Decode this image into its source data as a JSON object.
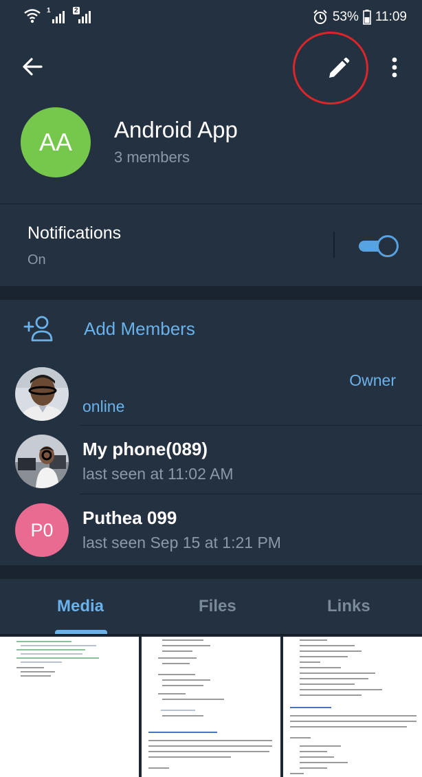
{
  "status_bar": {
    "sim1": "1",
    "sim2": "2",
    "battery_percent": "53%",
    "time": "11:09"
  },
  "header": {
    "group_name": "Android App",
    "member_count": "3 members",
    "avatar_initials": "AA",
    "avatar_color": "#76c84d"
  },
  "notifications": {
    "label": "Notifications",
    "value": "On",
    "enabled": true
  },
  "members_section": {
    "add_label": "Add Members",
    "members": [
      {
        "name": "",
        "status": "online",
        "role": "Owner"
      },
      {
        "name": "My phone(089)",
        "status": "last seen at 11:02 AM",
        "role": ""
      },
      {
        "name": "Puthea 099",
        "status": "last seen Sep 15 at 1:21 PM",
        "role": "",
        "initials": "P0",
        "avatar_color": "#ea6b91"
      }
    ]
  },
  "tabs": [
    {
      "label": "Media",
      "active": true
    },
    {
      "label": "Files",
      "active": false
    },
    {
      "label": "Links",
      "active": false
    }
  ],
  "icons": {
    "back": "arrow-left-icon",
    "edit": "pencil-icon",
    "more": "more-vertical-icon",
    "add_member": "add-person-icon"
  },
  "colors": {
    "background": "#1d2733",
    "panel": "#243140",
    "accent": "#6ab2ec",
    "muted_text": "#8a99a9",
    "annotation": "#d9262a"
  }
}
